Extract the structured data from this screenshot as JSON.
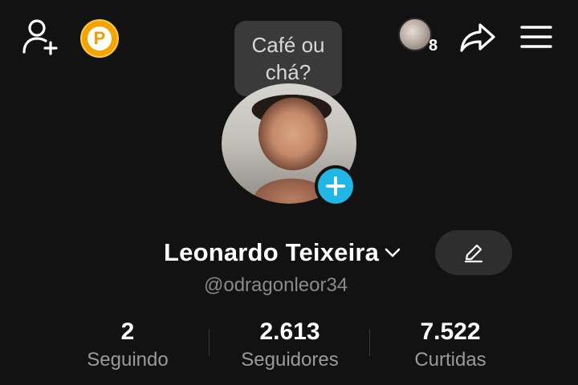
{
  "header": {
    "add_friend_icon": "person-plus-icon",
    "points_badge": "P",
    "visitors_count": "8",
    "share_icon": "share-arrow-icon",
    "menu_icon": "hamburger-menu-icon"
  },
  "tooltip": {
    "line1": "Café ou",
    "line2": "chá?"
  },
  "profile": {
    "display_name": "Leonardo Teixeira",
    "username": "@odragonleor34"
  },
  "stats": {
    "following": {
      "value": "2",
      "label": "Seguindo"
    },
    "followers": {
      "value": "2.613",
      "label": "Seguidores"
    },
    "likes": {
      "value": "7.522",
      "label": "Curtidas"
    }
  },
  "colors": {
    "background": "#121212",
    "accent_blue": "#20b6e6",
    "points_gold": "#f5a300",
    "secondary_text": "#8a8a8a"
  }
}
